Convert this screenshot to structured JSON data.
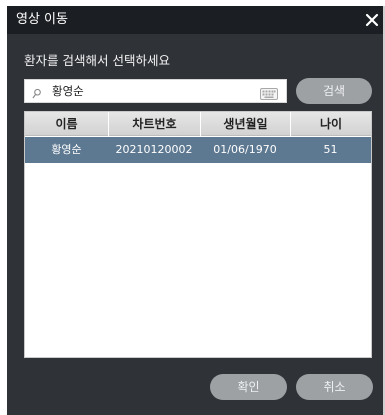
{
  "dialog": {
    "title": "영상 이동",
    "close_icon": "close-icon",
    "prompt": "환자를 검색해서 선택하세요"
  },
  "search": {
    "value": "황영순",
    "placeholder": "",
    "search_icon": "search-icon",
    "keyboard_icon": "keyboard-icon",
    "button_label": "검색"
  },
  "table": {
    "columns": [
      "이름",
      "차트번호",
      "생년월일",
      "나이"
    ],
    "rows": [
      {
        "name": "황영순",
        "chart_no": "20210120002",
        "birth": "01/06/1970",
        "age": "51",
        "selected": true
      }
    ]
  },
  "footer": {
    "confirm_label": "확인",
    "cancel_label": "취소"
  },
  "colors": {
    "dialog_bg": "#2f3338",
    "titlebar_bg": "#1b1e22",
    "button_bg": "#9ea1a4",
    "selected_row": "#5d7891",
    "header_bg": "#d9d9d9"
  }
}
